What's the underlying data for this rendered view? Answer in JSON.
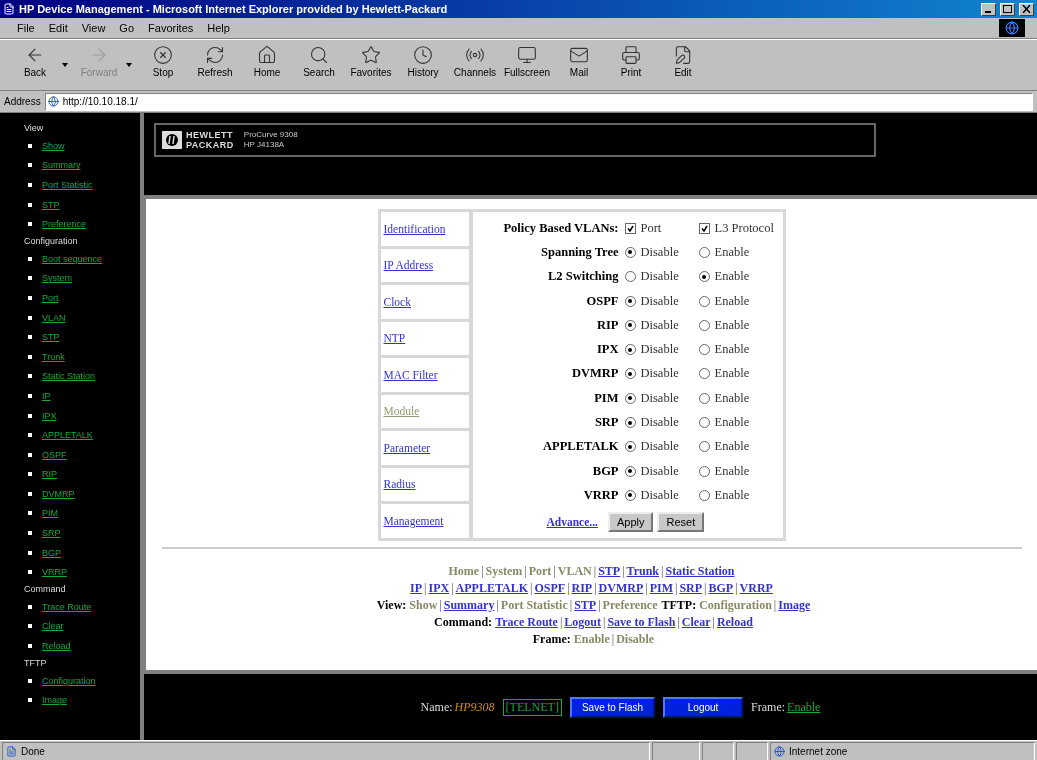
{
  "window": {
    "title": "HP Device Management - Microsoft Internet Explorer provided by Hewlett-Packard"
  },
  "menu": [
    "File",
    "Edit",
    "View",
    "Go",
    "Favorites",
    "Help"
  ],
  "toolbar": [
    {
      "label": "Back",
      "kind": "back",
      "disabled": false,
      "dropdown": true
    },
    {
      "label": "Forward",
      "kind": "forward",
      "disabled": true,
      "dropdown": true
    },
    {
      "label": "Stop",
      "kind": "stop",
      "disabled": false,
      "dropdown": false
    },
    {
      "label": "Refresh",
      "kind": "refresh",
      "disabled": false,
      "dropdown": false
    },
    {
      "label": "Home",
      "kind": "home",
      "disabled": false,
      "dropdown": false
    },
    {
      "label": "Search",
      "kind": "search",
      "disabled": false,
      "dropdown": false
    },
    {
      "label": "Favorites",
      "kind": "favorites",
      "disabled": false,
      "dropdown": false
    },
    {
      "label": "History",
      "kind": "history",
      "disabled": false,
      "dropdown": false
    },
    {
      "label": "Channels",
      "kind": "channels",
      "disabled": false,
      "dropdown": false
    },
    {
      "label": "Fullscreen",
      "kind": "fullscreen",
      "disabled": false,
      "dropdown": false
    },
    {
      "label": "Mail",
      "kind": "mail",
      "disabled": false,
      "dropdown": false
    },
    {
      "label": "Print",
      "kind": "print",
      "disabled": false,
      "dropdown": false
    },
    {
      "label": "Edit",
      "kind": "edit",
      "disabled": false,
      "dropdown": false
    }
  ],
  "address": {
    "label": "Address",
    "value": "http://10.10.18.1/"
  },
  "sidebar": [
    {
      "heading": "View",
      "items": [
        "Show",
        "Summary",
        "Port Statistic",
        "STP",
        "Preference"
      ]
    },
    {
      "heading": "Configuration",
      "items": [
        "Boot sequence",
        "System",
        "Port",
        "VLAN",
        "STP",
        "Trunk",
        "Static Station",
        "IP",
        "IPX",
        "APPLETALK",
        "OSPF",
        "RIP",
        "DVMRP",
        "PIM",
        "SRP",
        "BGP",
        "VRRP"
      ]
    },
    {
      "heading": "Command",
      "items": [
        "Trace Route",
        "Clear",
        "Reload"
      ]
    },
    {
      "heading": "TFTP",
      "items": [
        "Configuration",
        "Image"
      ]
    }
  ],
  "header": {
    "logo_top": "HEWLETT",
    "logo_bottom": "PACKARD",
    "product": "ProCurve 9308",
    "model": "HP J4138A"
  },
  "tabs": [
    {
      "label": "Identification",
      "visited": false
    },
    {
      "label": "IP Address",
      "visited": false
    },
    {
      "label": "Clock",
      "visited": false
    },
    {
      "label": "NTP",
      "visited": false
    },
    {
      "label": "MAC Filter",
      "visited": false
    },
    {
      "label": "Module",
      "visited": true
    },
    {
      "label": "Parameter",
      "visited": false
    },
    {
      "label": "Radius",
      "visited": false
    },
    {
      "label": "Management",
      "visited": false
    }
  ],
  "settings": [
    {
      "label": "Policy Based VLANs:",
      "kind": "checkbox",
      "options": [
        {
          "label": "Port",
          "checked": true
        },
        {
          "label": "L3 Protocol",
          "checked": true
        }
      ]
    },
    {
      "label": "Spanning Tree",
      "kind": "radio",
      "options": [
        {
          "label": "Disable",
          "selected": true
        },
        {
          "label": "Enable",
          "selected": false
        }
      ]
    },
    {
      "label": "L2 Switching",
      "kind": "radio",
      "options": [
        {
          "label": "Disable",
          "selected": false
        },
        {
          "label": "Enable",
          "selected": true
        }
      ]
    },
    {
      "label": "OSPF",
      "kind": "radio",
      "options": [
        {
          "label": "Disable",
          "selected": true
        },
        {
          "label": "Enable",
          "selected": false
        }
      ]
    },
    {
      "label": "RIP",
      "kind": "radio",
      "options": [
        {
          "label": "Disable",
          "selected": true
        },
        {
          "label": "Enable",
          "selected": false
        }
      ]
    },
    {
      "label": "IPX",
      "kind": "radio",
      "options": [
        {
          "label": "Disable",
          "selected": true
        },
        {
          "label": "Enable",
          "selected": false
        }
      ]
    },
    {
      "label": "DVMRP",
      "kind": "radio",
      "options": [
        {
          "label": "Disable",
          "selected": true
        },
        {
          "label": "Enable",
          "selected": false
        }
      ]
    },
    {
      "label": "PIM",
      "kind": "radio",
      "options": [
        {
          "label": "Disable",
          "selected": true
        },
        {
          "label": "Enable",
          "selected": false
        }
      ]
    },
    {
      "label": "SRP",
      "kind": "radio",
      "options": [
        {
          "label": "Disable",
          "selected": true
        },
        {
          "label": "Enable",
          "selected": false
        }
      ]
    },
    {
      "label": "APPLETALK",
      "kind": "radio",
      "options": [
        {
          "label": "Disable",
          "selected": true
        },
        {
          "label": "Enable",
          "selected": false
        }
      ]
    },
    {
      "label": "BGP",
      "kind": "radio",
      "options": [
        {
          "label": "Disable",
          "selected": true
        },
        {
          "label": "Enable",
          "selected": false
        }
      ]
    },
    {
      "label": "VRRP",
      "kind": "radio",
      "options": [
        {
          "label": "Disable",
          "selected": true
        },
        {
          "label": "Enable",
          "selected": false
        }
      ]
    }
  ],
  "form_actions": {
    "link": "Advance...",
    "buttons": [
      "Apply",
      "Reset"
    ]
  },
  "footer_links": {
    "separator": "|",
    "lines": [
      [
        {
          "text": "Home",
          "kind": "plain"
        },
        {
          "text": "System",
          "kind": "plain"
        },
        {
          "text": "Port",
          "kind": "plain"
        },
        {
          "text": "VLAN",
          "kind": "plain"
        },
        {
          "text": "STP",
          "kind": "link"
        },
        {
          "text": "Trunk",
          "kind": "link"
        },
        {
          "text": "Static Station",
          "kind": "link"
        }
      ],
      [
        {
          "text": "IP",
          "kind": "link"
        },
        {
          "text": "IPX",
          "kind": "link"
        },
        {
          "text": "APPLETALK",
          "kind": "link"
        },
        {
          "text": "OSPF",
          "kind": "link"
        },
        {
          "text": "RIP",
          "kind": "link"
        },
        {
          "text": "DVMRP",
          "kind": "link"
        },
        {
          "text": "PIM",
          "kind": "link"
        },
        {
          "text": "SRP",
          "kind": "link"
        },
        {
          "text": "BGP",
          "kind": "link"
        },
        {
          "text": "VRRP",
          "kind": "link"
        }
      ],
      [
        {
          "text": "View:",
          "kind": "label"
        },
        {
          "text": "Show",
          "kind": "plain"
        },
        {
          "text": "Summary",
          "kind": "link"
        },
        {
          "text": "Port Statistic",
          "kind": "plain"
        },
        {
          "text": "STP",
          "kind": "link"
        },
        {
          "text": "Preference",
          "kind": "plain"
        },
        {
          "text": "TFTP:",
          "kind": "label"
        },
        {
          "text": "Configuration",
          "kind": "plain"
        },
        {
          "text": "Image",
          "kind": "link"
        }
      ],
      [
        {
          "text": "Command:",
          "kind": "label"
        },
        {
          "text": "Trace Route",
          "kind": "link"
        },
        {
          "text": "Logout",
          "kind": "link"
        },
        {
          "text": "Save to Flash",
          "kind": "link"
        },
        {
          "text": "Clear",
          "kind": "link"
        },
        {
          "text": "Reload",
          "kind": "link"
        }
      ],
      [
        {
          "text": "Frame:",
          "kind": "label"
        },
        {
          "text": "Enable",
          "kind": "plain"
        },
        {
          "text": "Disable",
          "kind": "plain"
        }
      ]
    ]
  },
  "bottom_bar": {
    "name_label": "Name:",
    "name": "HP9308",
    "session": "[TELNET]",
    "buttons": [
      "Save to Flash",
      "Logout"
    ],
    "frame_label": "Frame:",
    "frame_link": "Enable"
  },
  "status_bar": {
    "text": "Done",
    "zone": "Internet zone"
  }
}
